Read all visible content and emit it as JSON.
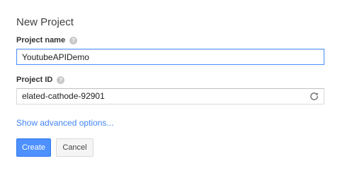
{
  "dialog": {
    "title": "New Project",
    "project_name": {
      "label": "Project name",
      "help_icon": "question-mark-icon",
      "value": "YoutubeAPIDemo"
    },
    "project_id": {
      "label": "Project ID",
      "help_icon": "question-mark-icon",
      "value": "elated-cathode-92901",
      "refresh_icon": "refresh-icon"
    },
    "advanced_link": "Show advanced options...",
    "buttons": {
      "create": "Create",
      "cancel": "Cancel"
    }
  },
  "colors": {
    "primary": "#4d90fe",
    "link": "#4285f4",
    "focus_border": "#4d90fe"
  }
}
